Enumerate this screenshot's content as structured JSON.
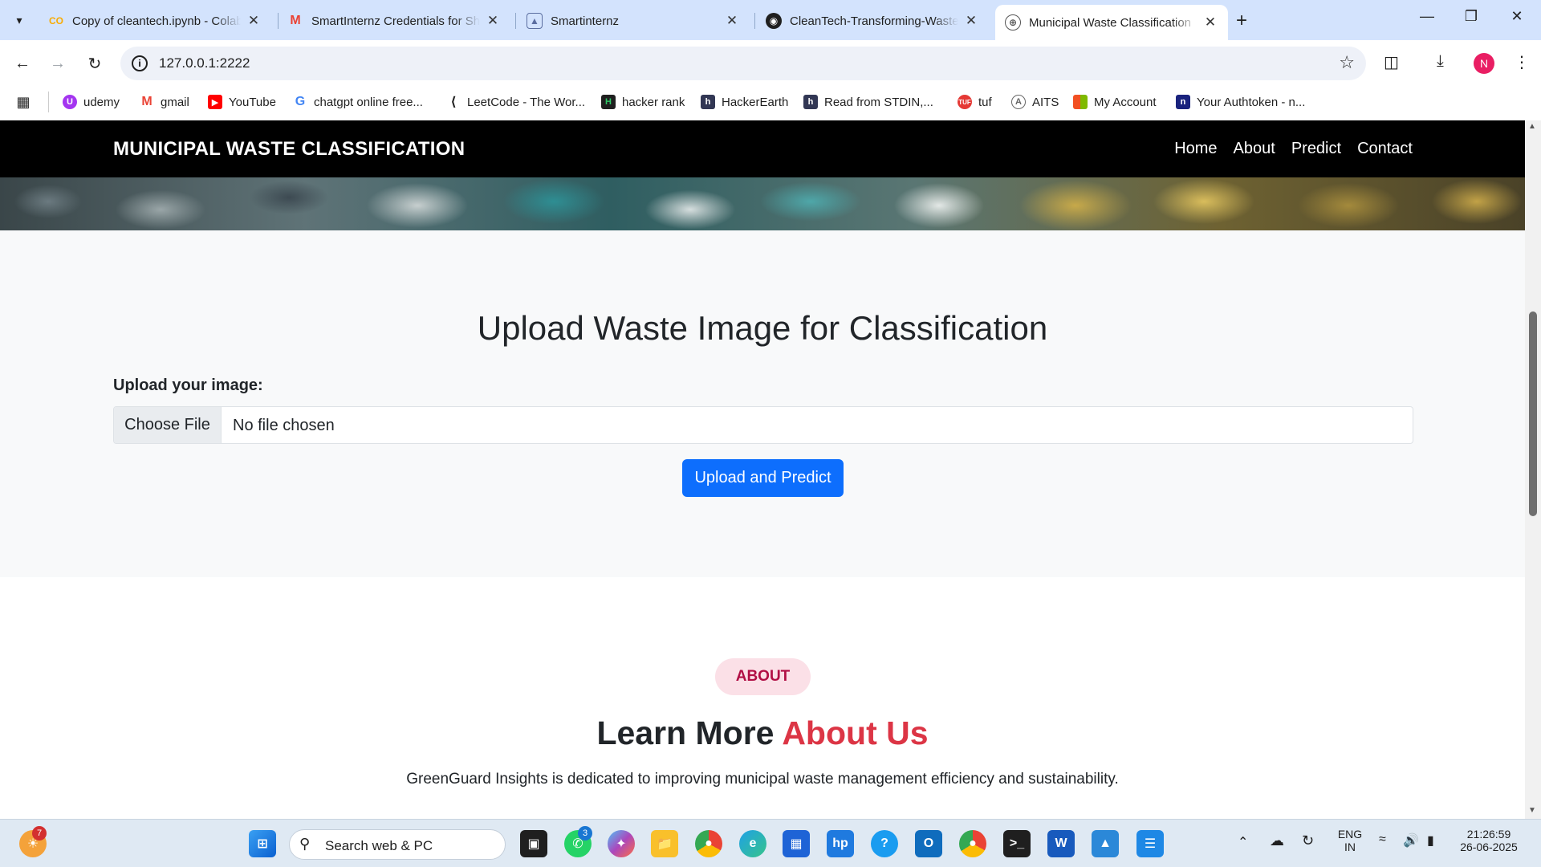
{
  "tabs": [
    {
      "title": "Copy of cleantech.ipynb - Colab",
      "favicon": "colab-icon"
    },
    {
      "title": "SmartInternz Credentials for Sh...",
      "favicon": "gmail-icon"
    },
    {
      "title": "Smartinternz",
      "favicon": "smartinternz-icon"
    },
    {
      "title": "CleanTech-Transforming-Waste...",
      "favicon": "github-icon"
    },
    {
      "title": "Municipal Waste Classification",
      "favicon": "globe-icon"
    }
  ],
  "address_bar": {
    "url": "127.0.0.1:2222"
  },
  "bookmarks": [
    {
      "label": "udemy"
    },
    {
      "label": "gmail"
    },
    {
      "label": "YouTube"
    },
    {
      "label": "chatgpt online free..."
    },
    {
      "label": "LeetCode - The Wor..."
    },
    {
      "label": "hacker rank"
    },
    {
      "label": "HackerEarth"
    },
    {
      "label": "Read from STDIN,..."
    },
    {
      "label": "tuf"
    },
    {
      "label": "AITS"
    },
    {
      "label": "My Account"
    },
    {
      "label": "Your Authtoken - n..."
    }
  ],
  "profile_initial": "N",
  "navbar": {
    "brand": "MUNICIPAL WASTE CLASSIFICATION",
    "links": [
      "Home",
      "About",
      "Predict",
      "Contact"
    ]
  },
  "upload": {
    "title": "Upload Waste Image for Classification",
    "label": "Upload your image:",
    "choose_file": "Choose File",
    "file_status": "No file chosen",
    "submit": "Upload and Predict"
  },
  "about": {
    "pill": "ABOUT",
    "heading_main": "Learn More ",
    "heading_accent": "About Us",
    "text": "GreenGuard Insights is dedicated to improving municipal waste management efficiency and sustainability."
  },
  "taskbar": {
    "search_placeholder": "Search web & PC",
    "widget_badge": "7",
    "whatsapp_badge": "3",
    "language": "ENG",
    "region": "IN",
    "time": "21:26:59",
    "date": "26-06-2025"
  },
  "colors": {
    "tabstrip": "#d3e3fd",
    "navbar": "#000000",
    "primary_button": "#0d6efd",
    "accent_red": "#dc3545",
    "pill_bg": "#fbe0e7"
  }
}
